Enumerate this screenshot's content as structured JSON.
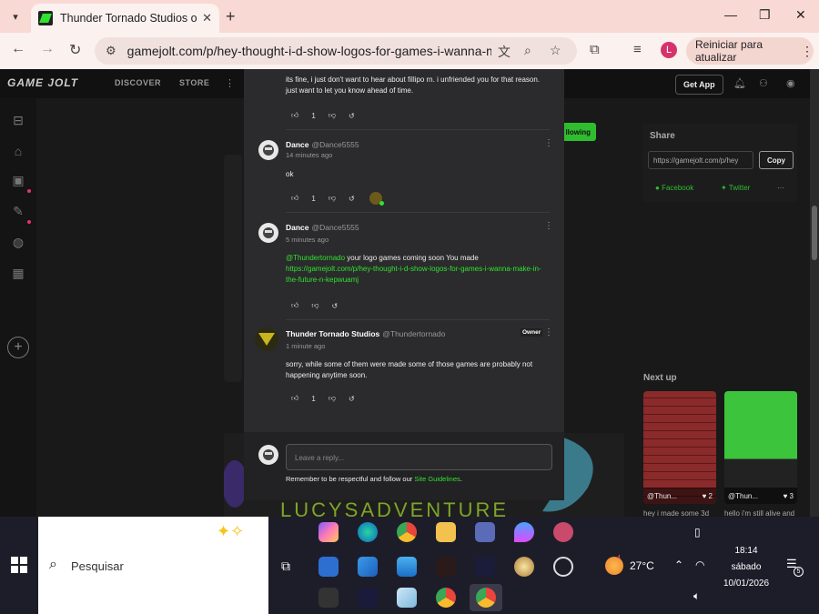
{
  "browser": {
    "tab_title": "Thunder Tornado Studios on Ga",
    "url": "gamejolt.com/p/hey-thought-i-d-show-logos-for-games-i-wanna-make...",
    "profile_initial": "L",
    "update_label": "Reiniciar para atualizar"
  },
  "gamejolt": {
    "logo": "GAME JOLT",
    "nav": {
      "discover": "DISCOVER",
      "store": "STORE"
    },
    "get_app": "Get App",
    "following": "llowing",
    "share": {
      "title": "Share",
      "url": "https://gamejolt.com/p/hey",
      "copy": "Copy",
      "facebook": "Facebook",
      "twitter": "Twitter",
      "more": "···"
    },
    "next_up": "Next up",
    "thumbs": [
      {
        "author": "@Thun...",
        "likes": "2",
        "caption": "hey i made some 3d"
      },
      {
        "author": "@Thun...",
        "likes": "3",
        "caption": "hello i'm still alive and"
      }
    ],
    "art_text": "LUCYSADVENTURE"
  },
  "comments": [
    {
      "body": "its fine, i just don't want to hear about fillipo rn. i unfriended you for that reason. just want to let you know ahead of time.",
      "likes": "1"
    },
    {
      "author": "Dance",
      "handle": "@Dance5555",
      "time": "14 minutes ago",
      "body": "ok",
      "likes": "1"
    },
    {
      "author": "Dance",
      "handle": "@Dance5555",
      "time": "5 minutes ago",
      "mention": "@Thundertornado",
      "body": " your logo games coming soon You made ",
      "link": "https://gamejolt.com/p/hey-thought-i-d-show-logos-for-games-i-wanna-make-in-the-future-n-kepwuamj"
    },
    {
      "author": "Thunder Tornado Studios",
      "handle": "@Thundertornado",
      "badge": "Owner",
      "time": "1 minute ago",
      "body": "sorry, while some of them were made some of those games are probably not happening anytime soon.",
      "likes": "1"
    }
  ],
  "reply": {
    "placeholder": "Leave a reply...",
    "guidelines_prefix": "Remember to be respectful and follow our ",
    "guidelines_link": "Site Guidelines",
    "guidelines_suffix": "."
  },
  "taskbar": {
    "search": "Pesquisar",
    "weather_badge": "4",
    "temperature": "27°C",
    "time": "18:14",
    "day": "sábado",
    "date": "10/01/2026",
    "notifications": "5"
  },
  "colors": {
    "accent_green": "#2fe32f",
    "chrome_bg": "#fbf1ef",
    "modal_bg": "#2b2a2c"
  }
}
